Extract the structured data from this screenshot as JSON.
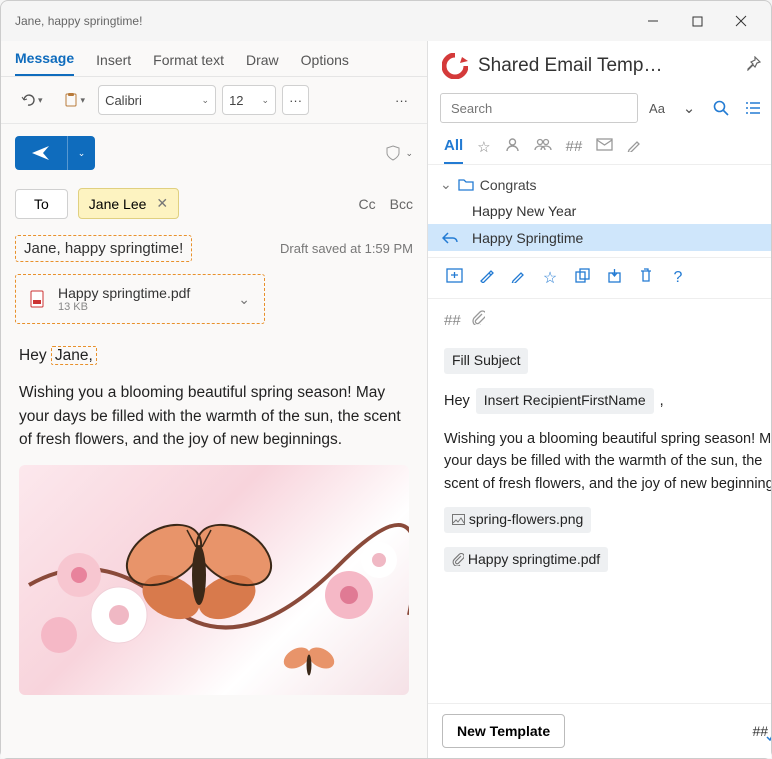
{
  "window": {
    "title": "Jane, happy springtime!"
  },
  "tabs": {
    "message": "Message",
    "insert": "Insert",
    "format": "Format text",
    "draw": "Draw",
    "options": "Options"
  },
  "format": {
    "font": "Calibri",
    "size": "12",
    "more1": "···",
    "more2": "···"
  },
  "compose": {
    "to_label": "To",
    "recipient": "Jane Lee",
    "cc": "Cc",
    "bcc": "Bcc",
    "subject": "Jane, happy springtime!",
    "draft_status": "Draft saved at 1:59 PM",
    "attachment": {
      "name": "Happy springtime.pdf",
      "size": "13 KB"
    },
    "greeting_pre": "Hey ",
    "greeting_name": "Jane,",
    "body": "Wishing you a blooming beautiful spring season! May your days be filled with the warmth of the sun, the scent of fresh flowers, and the joy of new beginnings."
  },
  "panel": {
    "title": "Shared Email Temp…",
    "search_placeholder": "Search",
    "aa": "Aa",
    "tab_all": "All",
    "hash": "##",
    "folder": "Congrats",
    "items": [
      "Happy New Year",
      "Happy Springtime"
    ],
    "meta_hash": "##",
    "fill_subject": "Fill Subject",
    "greet": "Hey",
    "insert_recip": "Insert RecipientFirstName",
    "comma": ",",
    "body": "Wishing you a blooming beautiful spring season! May your days be filled with the warmth of the sun, the scent of fresh flowers, and the joy of new beginnings.",
    "att_img": "spring-flowers.png",
    "att_pdf": "Happy springtime.pdf",
    "new_template": "New Template",
    "footer_hash": "##"
  }
}
